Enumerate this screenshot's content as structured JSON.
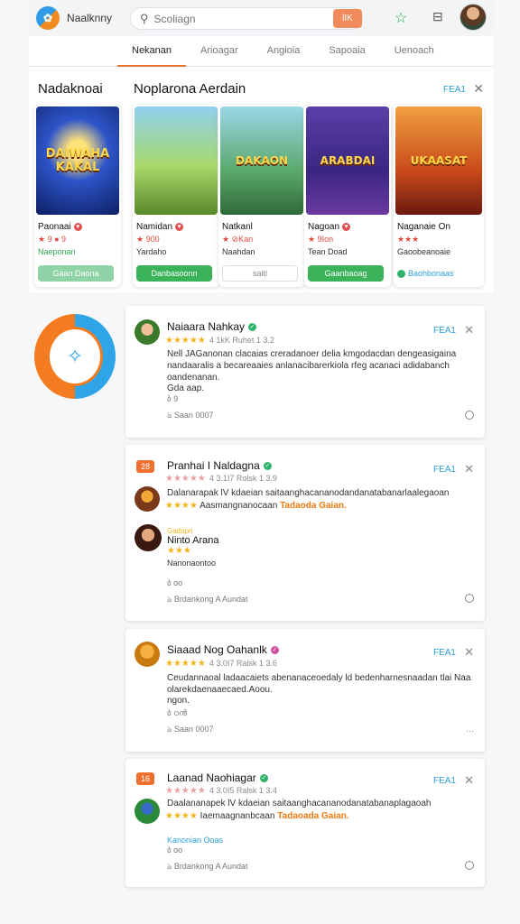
{
  "header": {
    "app_name": "Naalknny",
    "search_placeholder": "Scoliagn",
    "search_button": "lIK"
  },
  "tabs": [
    {
      "label": "Nekanan",
      "active": true
    },
    {
      "label": "Arioagar"
    },
    {
      "label": "Angioia"
    },
    {
      "label": "Sapoaia"
    },
    {
      "label": "Uenoach"
    }
  ],
  "featured": {
    "title_left": "Nadaknoai",
    "title": "Noplarona Aerdain",
    "link": "FEA1",
    "cards": [
      {
        "art_text": "DAIWAHA\nKAKAL",
        "title": "Paonaai",
        "rating": "★ 9 ● 9",
        "sub": "Naeponan",
        "button": "Gaan Daona",
        "btn_style": "light"
      },
      {
        "art_text": "",
        "title": "Namidan",
        "rating": "★ 900",
        "sub": "Yardaho",
        "button": "Danbasoonn",
        "btn_style": "green"
      },
      {
        "art_text": "DAKAON",
        "title": "Natkanl",
        "rating": "★ ⊘Kan",
        "sub": "Naahdan",
        "button": "saitl",
        "btn_style": "plain"
      },
      {
        "art_text": "ARABDAI",
        "title": "Nagoan",
        "rating": "★ 9Ion",
        "sub": "Tean Doad",
        "button": "Gaanbaoag",
        "btn_style": "green"
      },
      {
        "art_text": "UKAASAT",
        "title": "Naganaie On",
        "rating": "★★★",
        "sub": "Gaoobeanoaie",
        "button": "Baohbonaas",
        "btn_style": "link"
      }
    ]
  },
  "reviews": [
    {
      "name": "Naiaara Nahkay",
      "meta": "4 1kK Ruhet 1 3.2",
      "body": "Nell JAGanonan clacaias creradanoer delia kmgodacdan dengeasigaina nandaaralis a becareaaies anlanacibarerkiola rfeg acanaci adidabanch oandenanan.",
      "extra": "Gda aap.",
      "count": "ბ 9",
      "footer": "Saan 0007",
      "link": "FEA1"
    },
    {
      "name": "Pranhai I Naldagna",
      "meta": "4 3.1I7 Rolsk 1 3.9",
      "body": "Dalanarapak lV kdaeian saitaanghacananodandanatabanarlaalegaoan",
      "highlight_prefix": "Aasmangnanocaan",
      "highlight": "Tadaoda Gaian.",
      "sub_name": "Ninto Arana",
      "sub_tag": "Gadopn",
      "sub_body": "Nanonaontoo",
      "sub_count": "ბ oo",
      "footer": "Brdankong A Aundat",
      "badge": "28",
      "link": "FEA1"
    },
    {
      "name": "Siaaad Nog Oahanlk",
      "meta": "4 3.0I7 Ralsk 1 3.6",
      "body": "Ceudannaoal ladaacaiets abenanaceoedaly ld bedenharnesnaadan tlai Naa olarekdaenaaecaed.Aoou.",
      "extra": "ngon.",
      "count": "ბ ഠൻ",
      "footer": "Saan 0007",
      "link": "FEA1"
    },
    {
      "name": "Laanad Naohiagar",
      "meta": "4 3.0I5 Ralsk 1 3.4",
      "body": "Daalananapek lV kdaeian saitaanghacananodanatabanaplagaoah",
      "highlight_prefix": "Iaemaagnanbcaan",
      "highlight": "Tadaoada Gaian.",
      "tag": "Kanonian Ooas",
      "count": "ბ oo",
      "footer": "Brdankong A Aundat",
      "badge": "16",
      "link": "FEA1"
    }
  ]
}
